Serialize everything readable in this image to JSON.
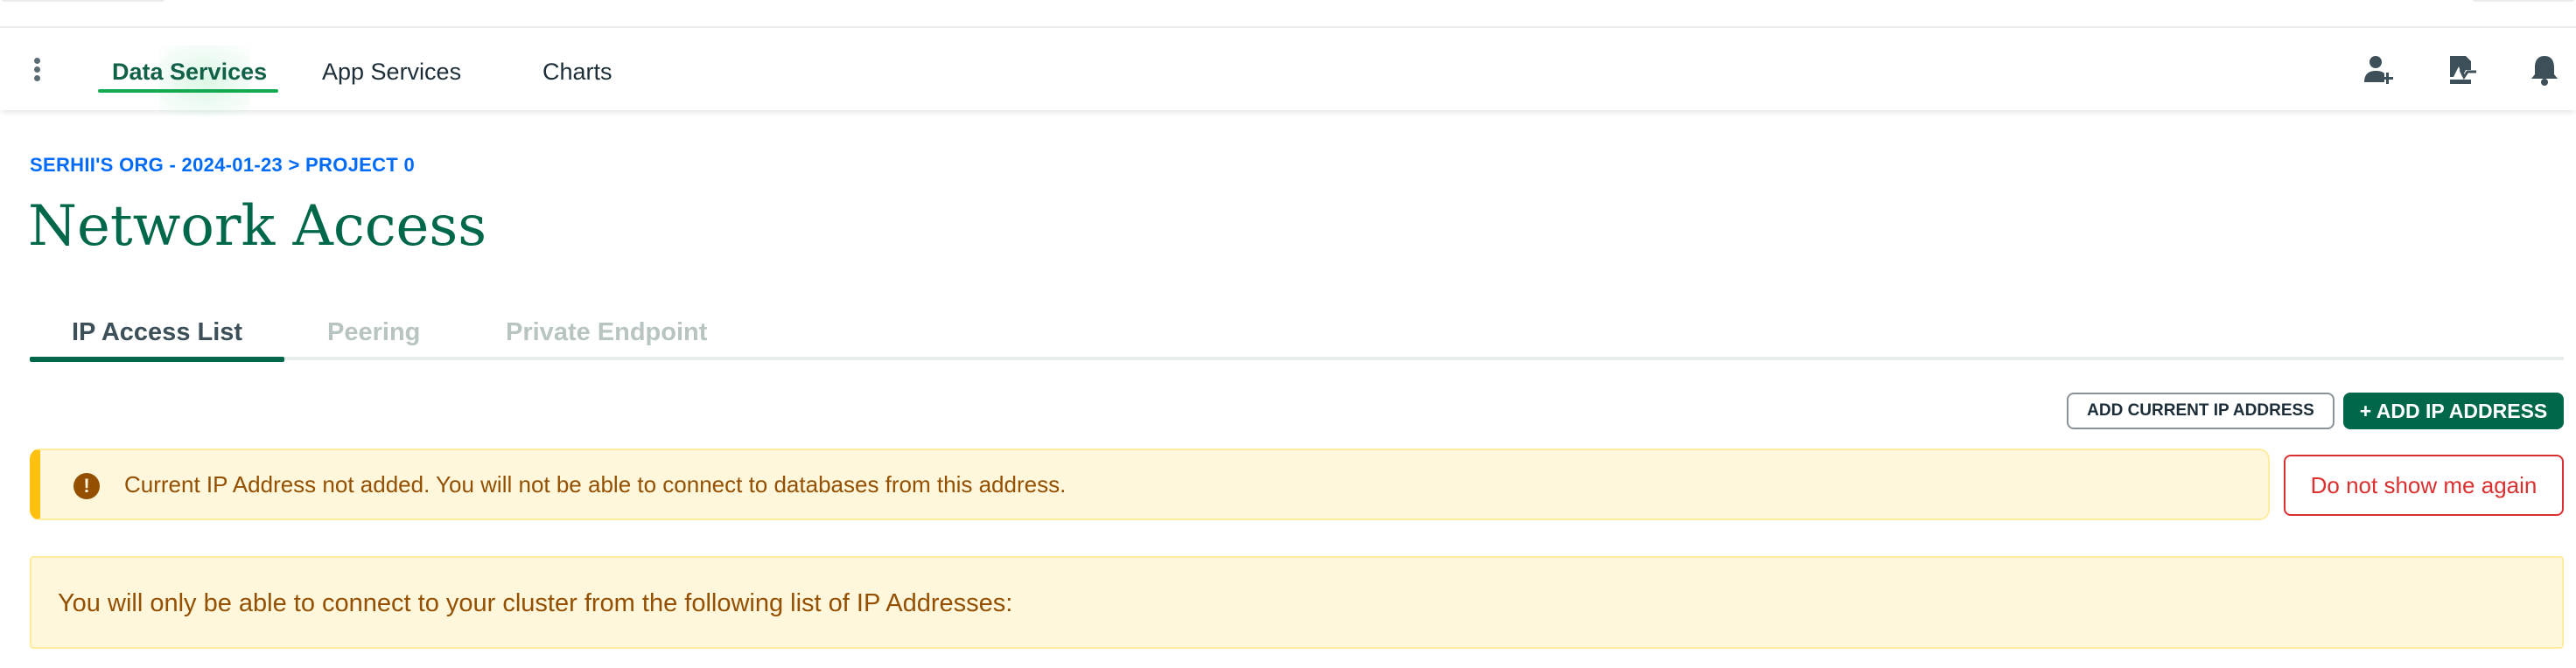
{
  "navbar": {
    "tabs": [
      {
        "label": "Data Services",
        "active": true
      },
      {
        "label": "App Services",
        "active": false
      },
      {
        "label": "Charts",
        "active": false
      }
    ],
    "icons": [
      "add-user-icon",
      "activity-feed-icon",
      "bell-icon"
    ]
  },
  "breadcrumb": "SERHII'S ORG - 2024-01-23 > PROJECT 0",
  "page_title": "Network Access",
  "tabs": [
    {
      "label": "IP Access List",
      "active": true
    },
    {
      "label": "Peering",
      "active": false
    },
    {
      "label": "Private Endpoint",
      "active": false
    }
  ],
  "actions": {
    "add_current_ip": "ADD CURRENT IP ADDRESS",
    "add_ip": "ADD IP ADDRESS",
    "add_ip_icon": "+"
  },
  "warning": {
    "icon": "!",
    "text": "Current IP Address not added. You will not be able to connect to databases from this address.",
    "dismiss": "Do not show me again"
  },
  "info": {
    "text": "You will only be able to connect to your cluster from the following list of IP Addresses:"
  },
  "colors": {
    "brand_green": "#00684a",
    "active_nav_green": "#13aa52",
    "link_blue": "#016bf8",
    "warning_bg": "#fef7db",
    "warning_accent": "#ffc010",
    "danger_red": "#db3030"
  }
}
